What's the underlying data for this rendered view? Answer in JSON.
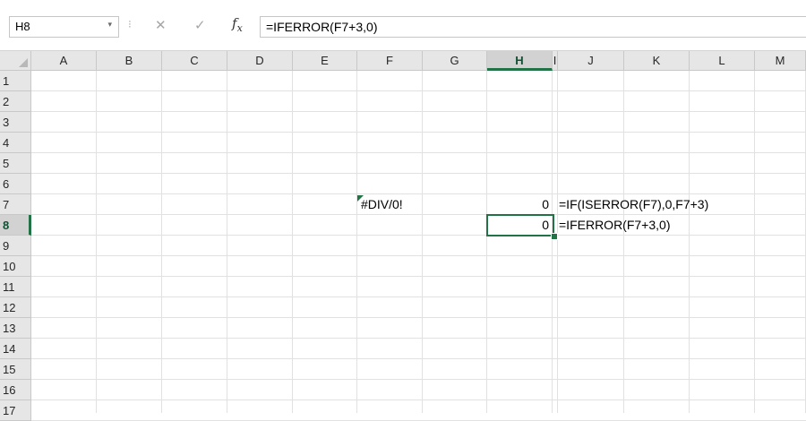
{
  "formula_bar": {
    "name_box": "H8",
    "name_box_arrow": "▾",
    "grip": "⁝",
    "cancel": "✕",
    "enter": "✓",
    "fx": "fx",
    "formula": "=IFERROR(F7+3,0)"
  },
  "columns": [
    "A",
    "B",
    "C",
    "D",
    "E",
    "F",
    "G",
    "H",
    "I",
    "J",
    "K",
    "L",
    "M"
  ],
  "rows": [
    "1",
    "2",
    "3",
    "4",
    "5",
    "6",
    "7",
    "8",
    "9",
    "10",
    "11",
    "12",
    "13",
    "14",
    "15",
    "16",
    "17"
  ],
  "cells": {
    "F7": "#DIV/0!",
    "H7": "0",
    "J7": "=IF(ISERROR(F7),0,F7+3)",
    "H8": "0",
    "J8": "=IFERROR(F7+3,0)"
  },
  "selection": {
    "active_cell": "H8",
    "column": "H",
    "row": "8"
  },
  "colors": {
    "accent": "#217346",
    "header_bg": "#e6e6e6",
    "gridline": "#e1e1e1"
  }
}
